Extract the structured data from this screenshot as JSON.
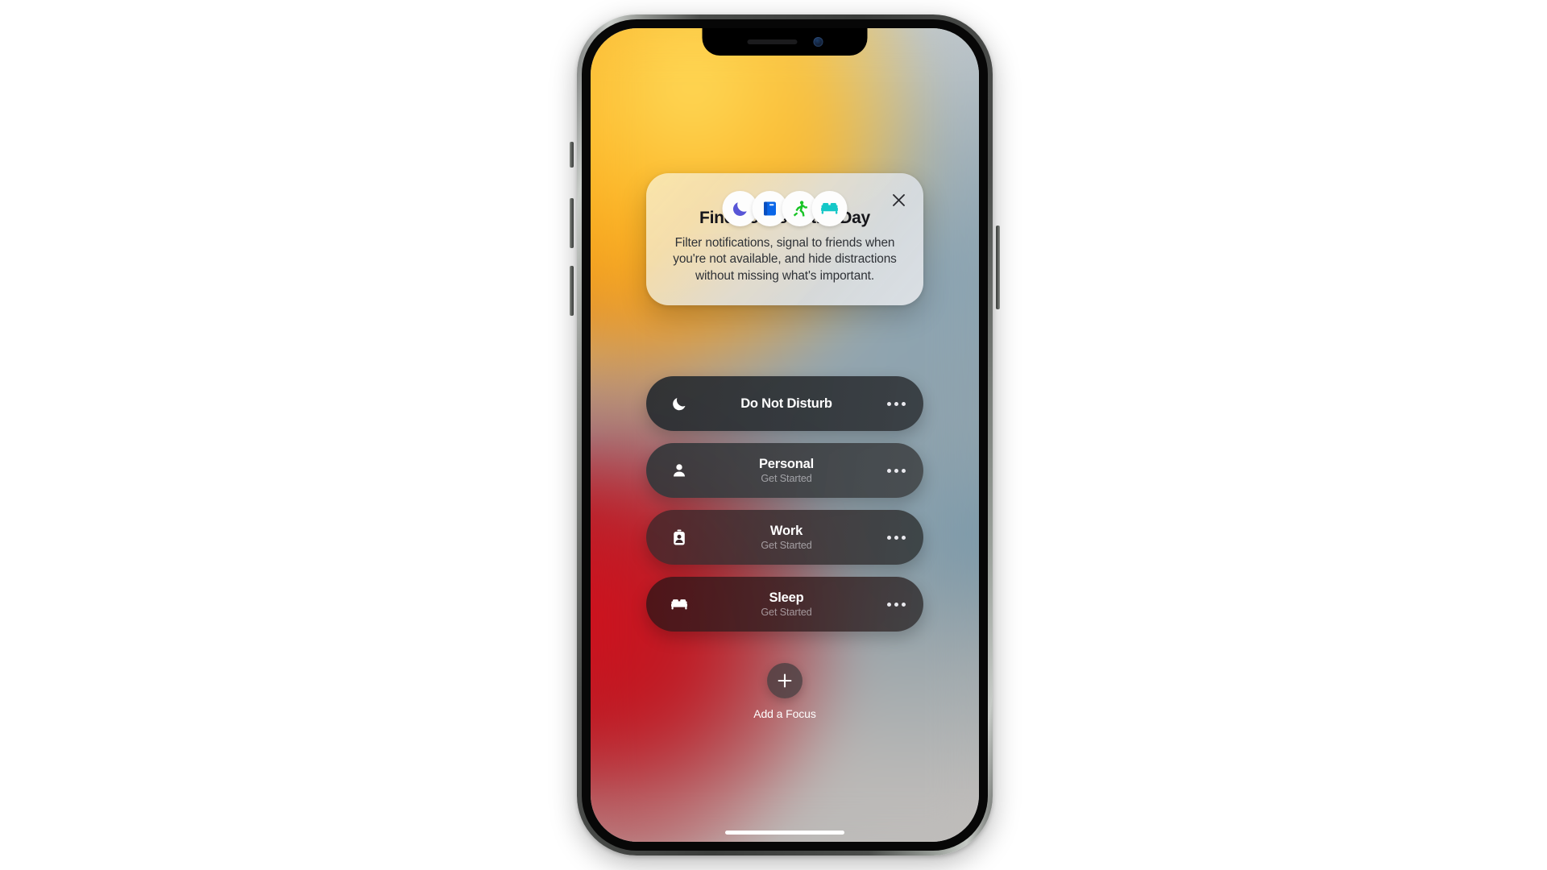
{
  "device": {
    "name": "iphone-12-pro",
    "notch": {
      "speaker": "speaker-grille",
      "camera": "front-camera"
    },
    "buttons": [
      "silent-switch",
      "volume-up",
      "volume-down",
      "side-power"
    ],
    "home_indicator": true
  },
  "wallpaper": {
    "name": "ios-15-abstract-gradient",
    "colors": [
      "#FFD84A",
      "#F59A0A",
      "#CD121E",
      "#84A0B0",
      "#B6BCC0",
      "#C0BEBC"
    ]
  },
  "card": {
    "title": "Find Focus in the Day",
    "body": "Filter notifications, signal to friends when you're not available, and hide distractions without missing what's important.",
    "close_label": "×",
    "icons": [
      {
        "name": "moon-icon",
        "glyph": "🌙",
        "color": "#5856D6"
      },
      {
        "name": "book-icon",
        "glyph": "📘",
        "color": "#0A66E8"
      },
      {
        "name": "running-person-icon",
        "glyph": "🏃",
        "color": "#18C426"
      },
      {
        "name": "bed-icon",
        "glyph": "🛏",
        "color": "#15C7C7"
      }
    ]
  },
  "focus_list": [
    {
      "id": "do-not-disturb",
      "title": "Do Not Disturb",
      "subtitle": "",
      "icon": "moon-icon",
      "more_label": "…"
    },
    {
      "id": "personal",
      "title": "Personal",
      "subtitle": "Get Started",
      "icon": "person-icon",
      "more_label": "…"
    },
    {
      "id": "work",
      "title": "Work",
      "subtitle": "Get Started",
      "icon": "id-badge-icon",
      "more_label": "…"
    },
    {
      "id": "sleep",
      "title": "Sleep",
      "subtitle": "Get Started",
      "icon": "bed-icon",
      "more_label": "…"
    }
  ],
  "add_focus": {
    "label": "Add a Focus",
    "icon": "plus-icon"
  }
}
